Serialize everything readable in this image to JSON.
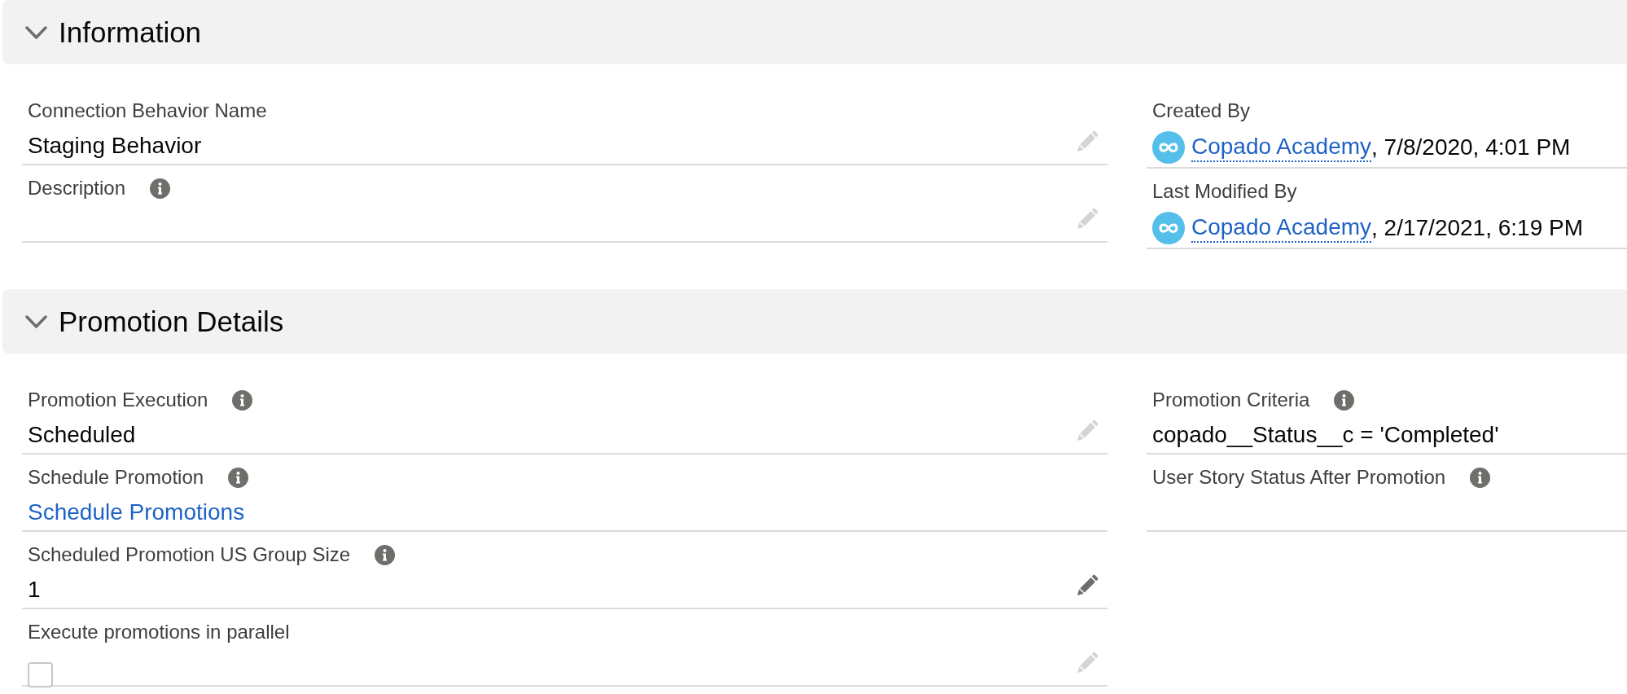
{
  "sections": [
    {
      "title": "Information",
      "expanded": true,
      "left_fields": [
        {
          "kind": "text",
          "label": "Connection Behavior Name",
          "info": false,
          "value": "Staging Behavior",
          "editable": true,
          "edit_hover": false
        },
        {
          "kind": "text",
          "label": "Description",
          "info": true,
          "editable": true,
          "edit_hover": false
        }
      ],
      "right_fields": [
        {
          "kind": "user_stamp",
          "label": "Created By",
          "info": false,
          "user": "Copado Academy",
          "timestamp": ", 7/8/2020, 4:01 PM",
          "editable": false
        },
        {
          "kind": "user_stamp",
          "label": "Last Modified By",
          "info": false,
          "user": "Copado Academy",
          "timestamp": ", 2/17/2021, 6:19 PM",
          "editable": false
        }
      ]
    },
    {
      "title": "Promotion Details",
      "expanded": true,
      "left_fields": [
        {
          "kind": "text",
          "label": "Promotion Execution",
          "info": true,
          "value": "Scheduled",
          "editable": true,
          "edit_hover": false
        },
        {
          "kind": "link",
          "label": "Schedule Promotion",
          "info": true,
          "value": "Schedule Promotions",
          "editable": false
        },
        {
          "kind": "text",
          "label": "Scheduled Promotion US Group Size",
          "info": true,
          "value": "1",
          "editable": true,
          "edit_hover": true
        },
        {
          "kind": "checkbox",
          "label": "Execute promotions in parallel",
          "info": false,
          "checked": false,
          "editable": true,
          "edit_hover": false
        }
      ],
      "right_fields": [
        {
          "kind": "text",
          "label": "Promotion Criteria",
          "info": true,
          "value": "copado__Status__c = 'Completed'",
          "editable": false
        },
        {
          "kind": "text",
          "label": "User Story Status After Promotion",
          "info": true,
          "editable": false
        }
      ]
    }
  ]
}
